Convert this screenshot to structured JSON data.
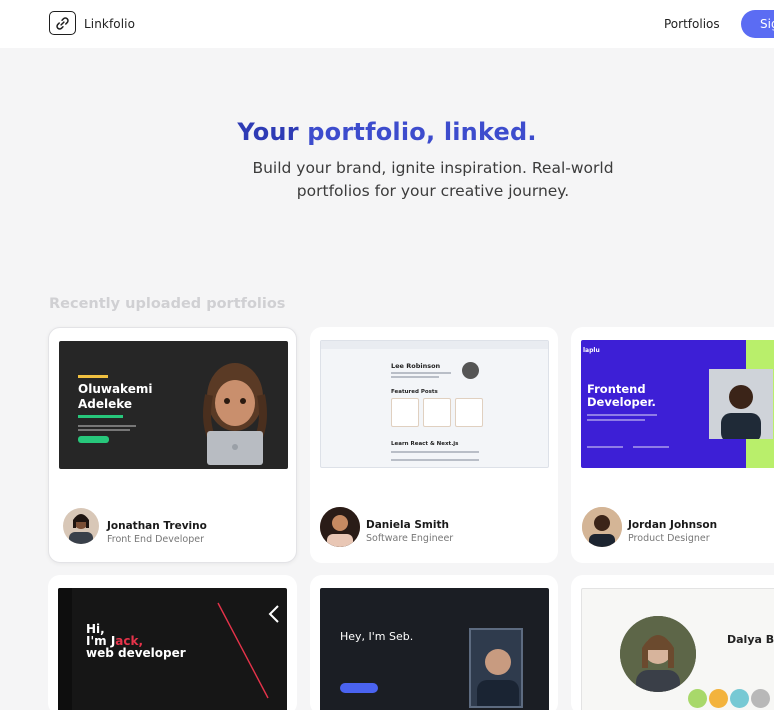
{
  "header": {
    "logo_text": "Linkfolio",
    "logo_icon": "link-icon",
    "nav_portfolios": "Portfolios",
    "signin_label": "Sig"
  },
  "hero": {
    "title_prefix": "Your ",
    "title_highlight": "portfolio, linked.",
    "subtitle": "Build your brand, ignite inspiration. Real-world portfolios for your creative journey."
  },
  "recent": {
    "section_title": "Recently uploaded portfolios",
    "cards": [
      {
        "name": "Jonathan Trevino",
        "role": "Front End Developer",
        "preview_heading_line1": "Oluwakemi",
        "preview_heading_line2": "Adeleke"
      },
      {
        "name": "Daniela Smith",
        "role": "Software Engineer",
        "preview_title": "Lee Robinson",
        "preview_section": "Featured Posts",
        "preview_section2": "Learn React & Next.js"
      },
      {
        "name": "Jordan Johnson",
        "role": "Product Designer",
        "preview_logo": "laplu",
        "preview_heading_line1": "Frontend",
        "preview_heading_line2": "Developer."
      },
      {
        "preview_heading_line1": "Hi,",
        "preview_heading_line2a": "I'm J",
        "preview_heading_line2b": "ack,",
        "preview_heading_line3": "web developer"
      },
      {
        "preview_heading": "Hey, I'm Seb."
      },
      {
        "preview_heading": "Dalya Baron"
      }
    ]
  },
  "colors": {
    "accent": "#5b6cf3",
    "title_blue": "#2e3bb5",
    "green": "#27c77b",
    "purple": "#3d1fd6",
    "lime": "#b9ef6b"
  }
}
